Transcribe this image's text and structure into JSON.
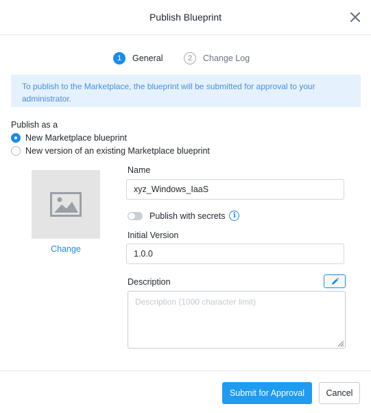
{
  "dialog": {
    "title": "Publish Blueprint",
    "close_icon": "close-icon"
  },
  "steps": [
    {
      "number": "1",
      "label": "General",
      "active": true
    },
    {
      "number": "2",
      "label": "Change Log",
      "active": false
    }
  ],
  "info_banner": "To publish to the Marketplace, the blueprint will be submitted for approval to your administrator.",
  "publish_as": {
    "label": "Publish as a",
    "options": [
      {
        "label": "New Marketplace blueprint",
        "selected": true
      },
      {
        "label": "New version of an existing Marketplace blueprint",
        "selected": false
      }
    ]
  },
  "image": {
    "icon": "image-placeholder-icon",
    "change_label": "Change"
  },
  "form": {
    "name_label": "Name",
    "name_value": "xyz_Windows_IaaS",
    "secrets_toggle_label": "Publish with secrets",
    "secrets_enabled": false,
    "info_icon_glyph": "i",
    "version_label": "Initial Version",
    "version_value": "1.0.0",
    "description_label": "Description",
    "description_placeholder": "Description (1000 character limit)",
    "description_value": ""
  },
  "footer": {
    "submit_label": "Submit for Approval",
    "cancel_label": "Cancel"
  },
  "colors": {
    "accent": "#1b8bea",
    "submit_bg": "#1f9bf0",
    "banner_bg": "#e5f1fc",
    "banner_text": "#4c8fd6"
  }
}
